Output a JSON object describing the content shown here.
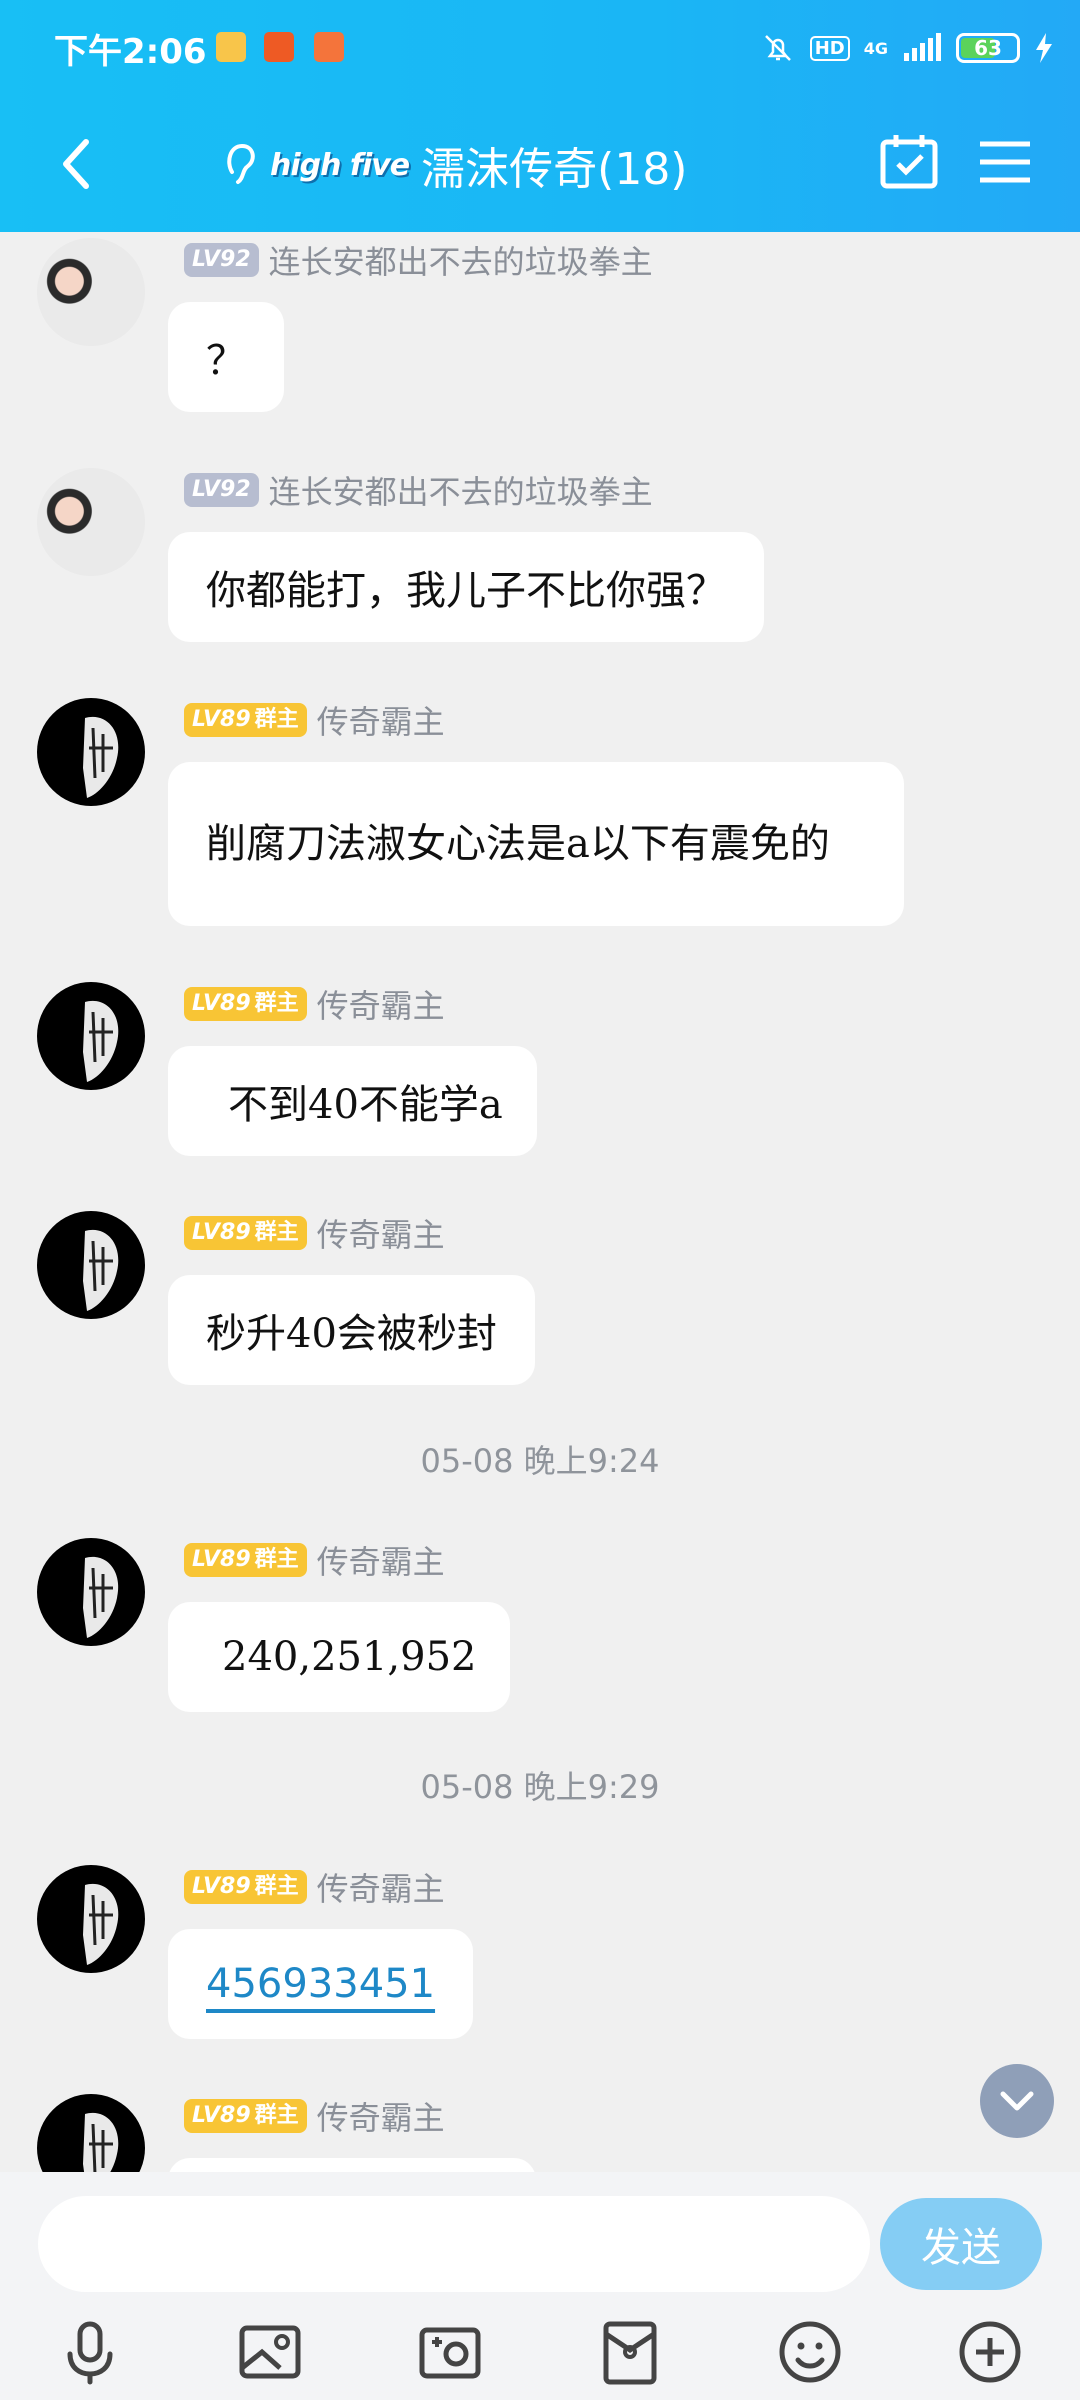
{
  "status_bar": {
    "time": "下午2:06",
    "hd": "HD",
    "network": "4G",
    "battery": "63"
  },
  "header": {
    "title": "濡沫传奇(18)",
    "brand": "high five"
  },
  "messages": [
    {
      "sender": "连长安都出不去的垃圾拳主",
      "level": "LV92",
      "role": "",
      "text": "？"
    },
    {
      "sender": "连长安都出不去的垃圾拳主",
      "level": "LV92",
      "role": "",
      "text": "你都能打，我儿子不比你强？"
    },
    {
      "sender": "传奇霸主",
      "level": "LV89",
      "role": "群主",
      "text": "削腐刀法淑女心法是a以下有震免的"
    },
    {
      "sender": "传奇霸主",
      "level": "LV89",
      "role": "群主",
      "text": "不到40不能学a"
    },
    {
      "sender": "传奇霸主",
      "level": "LV89",
      "role": "群主",
      "text": "秒升40会被秒封"
    },
    {
      "sender": "传奇霸主",
      "level": "LV89",
      "role": "群主",
      "text": "240,251,952"
    },
    {
      "sender": "传奇霸主",
      "level": "LV89",
      "role": "群主",
      "text": "456933451"
    },
    {
      "sender": "传奇霸主",
      "level": "LV89",
      "role": "群主",
      "text": ""
    }
  ],
  "timestamps": [
    "05-08 晚上9:24",
    "05-08 晚上9:29"
  ],
  "composer": {
    "placeholder": "",
    "send_label": "发送"
  },
  "colors": {
    "header_bg": "#1ab6f5",
    "gold_badge": "#f8c535",
    "grey_badge": "#b7bdd0",
    "link": "#1e88c7",
    "send_button": "#85cdf4"
  },
  "icons": [
    "back-icon",
    "ear-icon",
    "calendar-check-icon",
    "menu-icon",
    "chevron-down-icon",
    "microphone-icon",
    "image-icon",
    "camera-icon",
    "red-packet-icon",
    "emoji-icon",
    "plus-icon"
  ]
}
